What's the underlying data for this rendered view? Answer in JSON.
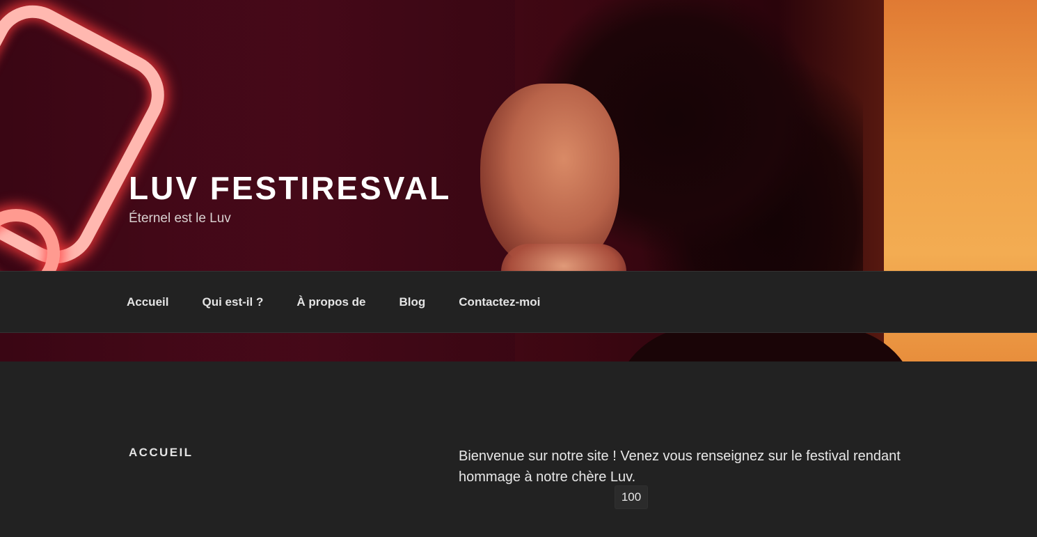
{
  "header": {
    "site_title": "LUV FESTIRESVAL",
    "tagline": "Éternel est le Luv"
  },
  "navigation": {
    "items": [
      {
        "label": "Accueil"
      },
      {
        "label": "Qui est-il ?"
      },
      {
        "label": "À propos de"
      },
      {
        "label": "Blog"
      },
      {
        "label": "Contactez-moi"
      }
    ]
  },
  "main": {
    "page_title": "ACCUEIL",
    "paragraph": "Bienvenue sur notre site ! Venez vous renseignez sur le festival rendant hommage à notre chère Luv.",
    "counter_value": "100"
  },
  "colors": {
    "background": "#222222",
    "nav_text": "#e4e4e4",
    "title_text": "#ffffff"
  }
}
